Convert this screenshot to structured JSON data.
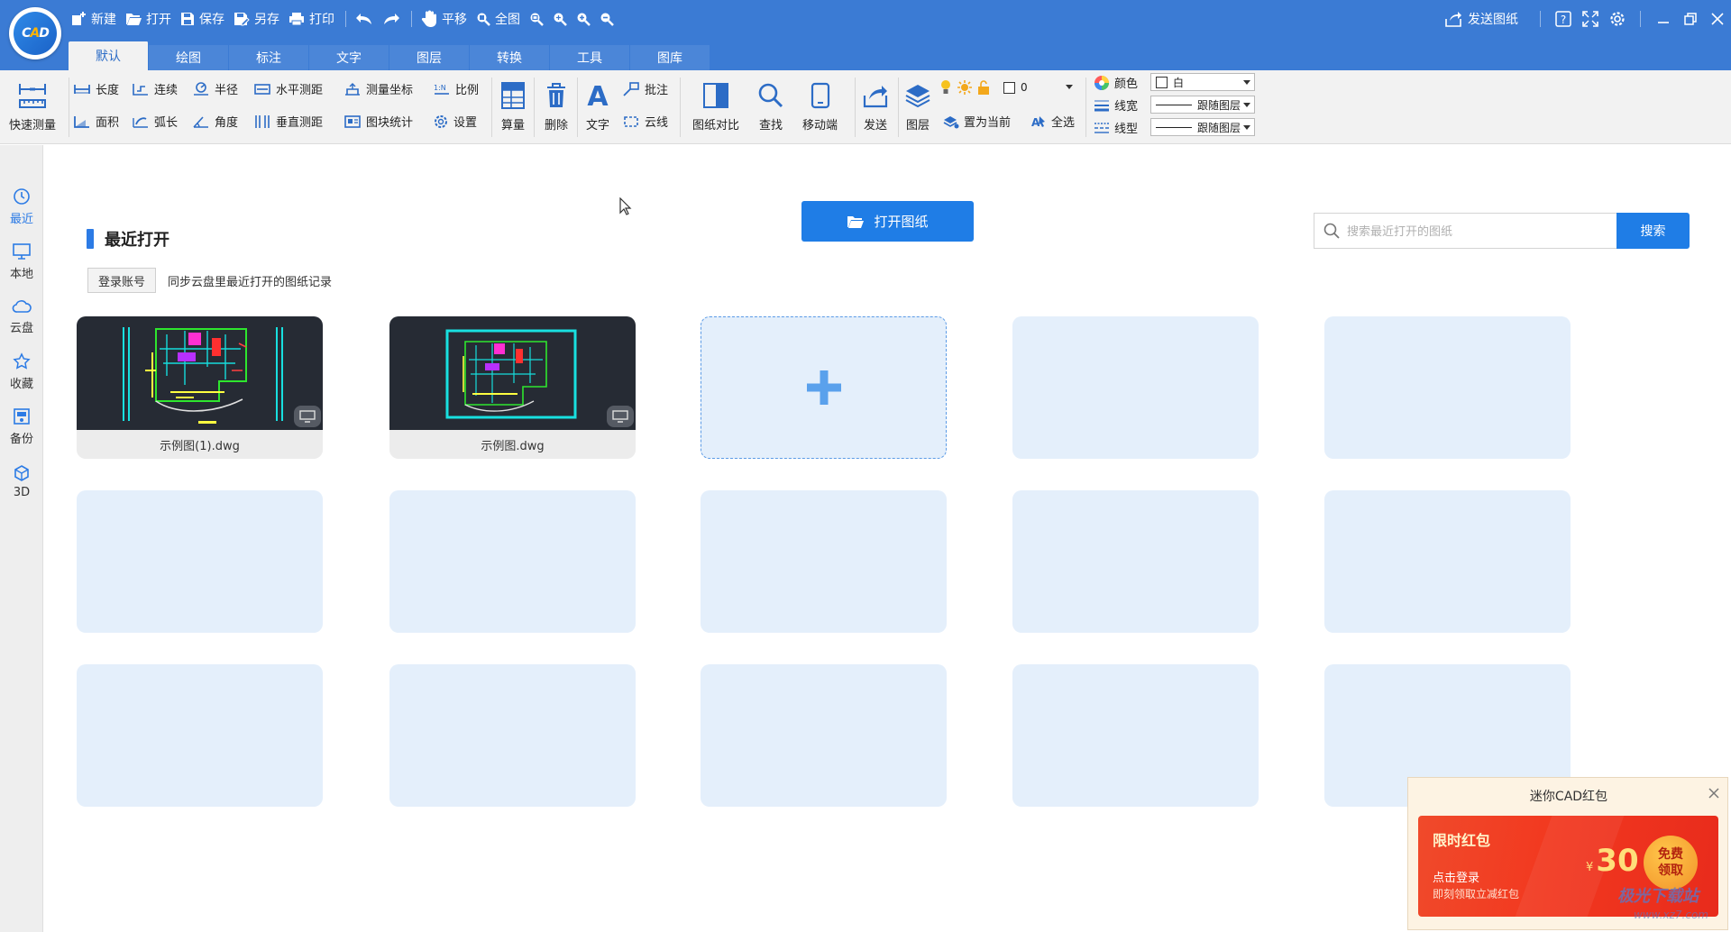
{
  "logo": {
    "text_a": "C",
    "text_b": "A",
    "text_c": "D"
  },
  "quickbar": {
    "new": "新建",
    "open": "打开",
    "save": "保存",
    "saveas": "另存",
    "print": "打印",
    "pan": "平移",
    "fit": "全图"
  },
  "window": {
    "send": "发送图纸"
  },
  "tabs": [
    "默认",
    "绘图",
    "标注",
    "文字",
    "图层",
    "转换",
    "工具",
    "图库"
  ],
  "ribbon": {
    "quick_measure": "快速测量",
    "length": "长度",
    "area": "面积",
    "continuous": "连续",
    "arc_length": "弧长",
    "radius": "半径",
    "angle": "角度",
    "h_dist": "水平测距",
    "v_dist": "垂直测距",
    "measure_coord": "测量坐标",
    "block_stats": "图块统计",
    "scale": "比例",
    "settings": "设置",
    "calc": "算量",
    "delete": "删除",
    "text": "文字",
    "annotate": "批注",
    "cloud_line": "云线",
    "compare": "图纸对比",
    "find": "查找",
    "mobile": "移动端",
    "send": "发送",
    "layer": "图层",
    "set_current": "置为当前",
    "select_all": "全选",
    "layer_value": "0",
    "color_label": "颜色",
    "color_value": "白",
    "linewidth_label": "线宽",
    "linewidth_value": "跟随图层",
    "linetype_label": "线型",
    "linetype_value": "跟随图层"
  },
  "leftnav": [
    {
      "label": "最近",
      "icon": "clock-icon"
    },
    {
      "label": "本地",
      "icon": "monitor-icon"
    },
    {
      "label": "云盘",
      "icon": "cloud-icon"
    },
    {
      "label": "收藏",
      "icon": "star-icon"
    },
    {
      "label": "备份",
      "icon": "backup-icon"
    },
    {
      "label": "3D",
      "icon": "cube-icon"
    }
  ],
  "main": {
    "section_title": "最近打开",
    "login_button": "登录账号",
    "sync_text": "同步云盘里最近打开的图纸记录",
    "open_button": "打开图纸",
    "search_placeholder": "搜索最近打开的图纸",
    "search_button": "搜索",
    "files": [
      {
        "name": "示例图(1).dwg"
      },
      {
        "name": "示例图.dwg"
      }
    ]
  },
  "popup": {
    "title": "迷你CAD红包",
    "pack_title": "限时红包",
    "line1": "点击登录",
    "line2": "即刻领取立减红包",
    "currency": "¥",
    "amount": "30",
    "claim_l1": "免费",
    "claim_l2": "领取"
  },
  "watermark": {
    "text": "极光下载站",
    "url": "www.xz7.com"
  },
  "colors": {
    "titlebar": "#3b7bd4",
    "accent": "#1f7de6",
    "card_placeholder": "#e4effb"
  }
}
